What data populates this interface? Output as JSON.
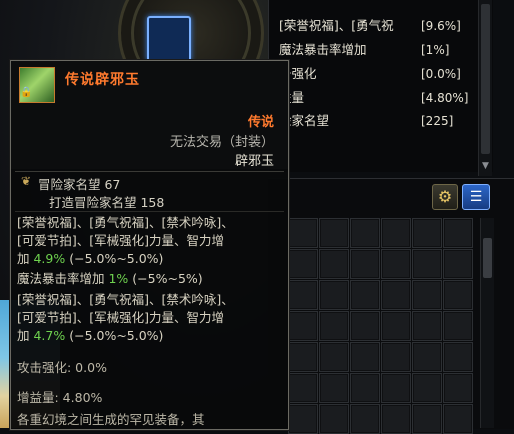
{
  "stat_panel": {
    "rows": [
      {
        "label": "[荣誉祝福]、[勇气祝",
        "value": "[9.6%]"
      },
      {
        "label": "魔法暴击率增加",
        "value": "[1%]"
      },
      {
        "label": "击强化",
        "value": "[0.0%]"
      },
      {
        "label": "益量",
        "value": "[4.80%]"
      },
      {
        "label": "险家名望",
        "value": "[225]"
      }
    ]
  },
  "inventory": {
    "gear_icon": "gear-icon",
    "list_icon": "list-icon"
  },
  "tooltip": {
    "item_name": "传说辟邪玉",
    "grade": "传说",
    "trade": "无法交易（封装）",
    "type": "辟邪玉",
    "fame": "冒险家名望 67",
    "craft_fame": "打造冒险家名望 158",
    "effect1_l1": "[荣誉祝福]、[勇气祝福]、[禁术吟咏]、",
    "effect1_l2": "[可爱节拍]、[军械强化]力量、智力增",
    "effect1_l3a": "加 ",
    "effect1_val": "4.9%",
    "effect1_range": " (−5.0%~5.0%)",
    "effect2_label": "魔法暴击率增加 ",
    "effect2_val": "1%",
    "effect2_range": " (−5%~5%)",
    "effect3_l1": "[荣誉祝福]、[勇气祝福]、[禁术吟咏]、",
    "effect3_l2": "[可爱节拍]、[军械强化]力量、智力增",
    "effect3_l3a": "加 ",
    "effect3_val": "4.7%",
    "effect3_range": " (−5.0%~5.0%)",
    "attack_boost": "攻击强化: 0.0%",
    "gain_amount": "增益量: 4.80%",
    "description": "各重幻境之间生成的罕见装备，其"
  }
}
